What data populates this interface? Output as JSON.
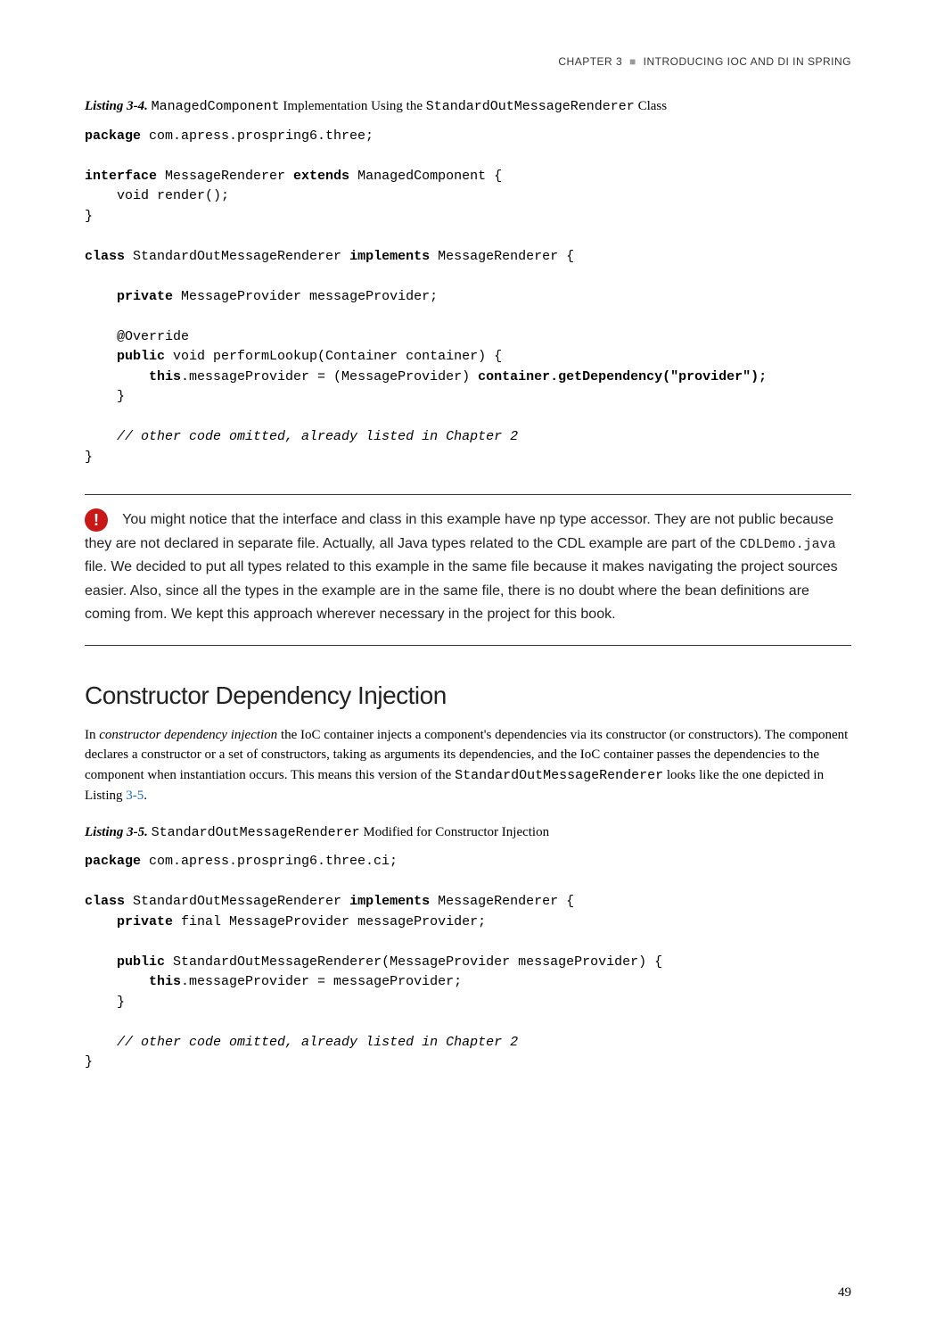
{
  "header": {
    "chapter": "CHAPTER 3",
    "title": "INTRODUCING IOC AND DI IN SPRING"
  },
  "listing34": {
    "prefix": "Listing 3-4.",
    "code1": "ManagedComponent",
    "middle": " Implementation Using the ",
    "code2": "StandardOutMessageRenderer",
    "suffix": " Class"
  },
  "code1": {
    "l1a": "package",
    "l1b": " com.apress.prospring6.three;",
    "l2a": "interface",
    "l2b": " MessageRenderer ",
    "l2c": "extends",
    "l2d": " ManagedComponent {",
    "l3": "    void render();",
    "l4": "}",
    "l5a": "class",
    "l5b": " StandardOutMessageRenderer ",
    "l5c": "implements",
    "l5d": " MessageRenderer {",
    "l6a": "    ",
    "l6b": "private",
    "l6c": " MessageProvider messageProvider;",
    "l7": "    @Override",
    "l8a": "    ",
    "l8b": "public",
    "l8c": " void performLookup(Container container) {",
    "l9a": "        ",
    "l9b": "this",
    "l9c": ".messageProvider = (MessageProvider) ",
    "l9d": "container.getDependency(\"provider\");",
    "l10": "    }",
    "l11a": "    ",
    "l11b": "// other code omitted, already listed in Chapter 2",
    "l12": "}"
  },
  "note": {
    "t1": "       You might notice that the interface and class in this example have np type accessor. They are not public because they are not declared in separate file. Actually, all Java types related to the CDL example are part of the ",
    "code1": "CDLDemo.java",
    "t2": " file. We decided to put all types related to this example in the same file because it makes navigating the project sources easier. Also, since all the types in the example are in the same file, there is no doubt where the bean definitions are coming from. We kept this approach wherever necessary in the project for this book."
  },
  "section": {
    "title": "Constructor Dependency Injection"
  },
  "para1": {
    "t1": "In ",
    "italic": "constructor dependency injection",
    "t2": " the IoC container injects a component's dependencies via its constructor (or constructors). The component declares a constructor or a set of constructors, taking as arguments its dependencies, and the IoC container passes the dependencies to the component when instantiation occurs. This means this version of the ",
    "code": "StandardOutMessageRenderer",
    "t3": " looks like the one depicted in Listing ",
    "link": "3-5",
    "t4": "."
  },
  "listing35": {
    "prefix": "Listing 3-5.",
    "code": "StandardOutMessageRenderer",
    "suffix": " Modified for Constructor Injection"
  },
  "code2": {
    "l1a": "package",
    "l1b": " com.apress.prospring6.three.ci;",
    "l2a": "class",
    "l2b": " StandardOutMessageRenderer ",
    "l2c": "implements",
    "l2d": " MessageRenderer {",
    "l3a": "    ",
    "l3b": "private",
    "l3c": " final MessageProvider messageProvider;",
    "l4a": "    ",
    "l4b": "public",
    "l4c": " StandardOutMessageRenderer(MessageProvider messageProvider) {",
    "l5a": "        ",
    "l5b": "this",
    "l5c": ".messageProvider = messageProvider;",
    "l6": "    }",
    "l7a": "    ",
    "l7b": "// other code omitted, already listed in Chapter 2",
    "l8": "}"
  },
  "pageNum": "49"
}
